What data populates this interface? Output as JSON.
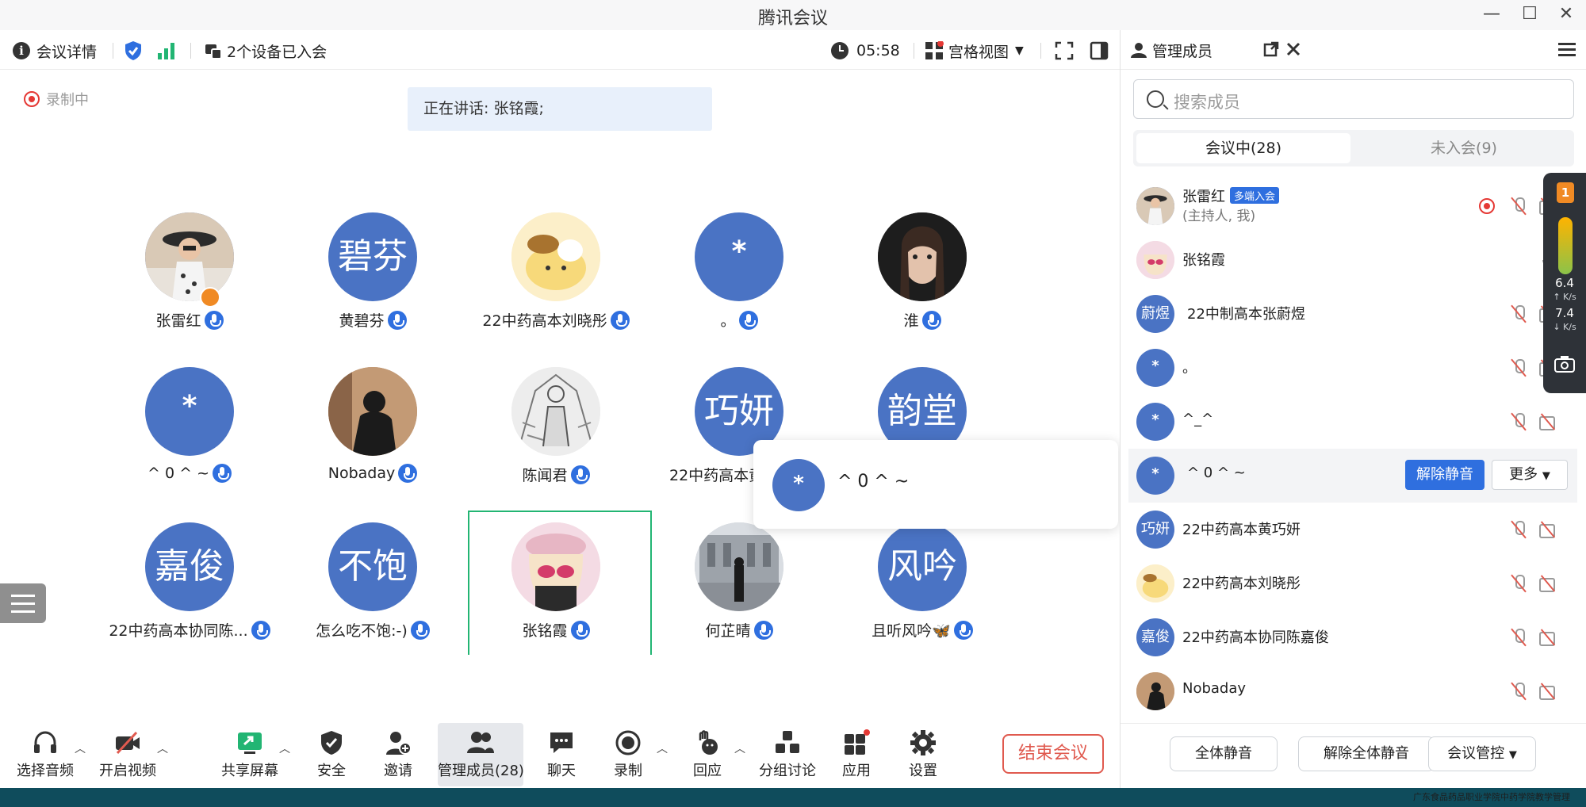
{
  "window": {
    "title": "腾讯会议"
  },
  "toolbar": {
    "meeting_details": "会议详情",
    "devices_joined": "2个设备已入会",
    "timer": "05:58",
    "view_mode": "宫格视图"
  },
  "recording": {
    "label": "录制中"
  },
  "speaking": {
    "text": "正在讲话: 张铭霞;"
  },
  "grid": {
    "tiles": [
      {
        "name": "张雷红",
        "avatar": "",
        "photo": "woman-hat"
      },
      {
        "name": "黄碧芬",
        "avatar": "碧芬"
      },
      {
        "name": "22中药高本刘晓彤",
        "avatar": "",
        "photo": "cartoon-dog"
      },
      {
        "name": "。",
        "avatar": "*"
      },
      {
        "name": "淮",
        "avatar": "",
        "photo": "girl-portrait"
      },
      {
        "name": "^ 0 ^ ~",
        "avatar": "*"
      },
      {
        "name": "Nobaday",
        "avatar": "",
        "photo": "dark-figure"
      },
      {
        "name": "陈闻君",
        "avatar": "",
        "photo": "sketch"
      },
      {
        "name": "22中药高本黄巧妍",
        "avatar": "巧妍"
      },
      {
        "name": "",
        "avatar": "韵堂"
      },
      {
        "name": "22中药高本协同陈...",
        "avatar": "嘉俊"
      },
      {
        "name": "怎么吃不饱:-)",
        "avatar": "不饱"
      },
      {
        "name": "张铭霞",
        "avatar": "",
        "photo": "anime-girl"
      },
      {
        "name": "何芷晴",
        "avatar": "",
        "photo": "building"
      },
      {
        "name": "且听风吟🦋",
        "avatar": "风吟"
      }
    ]
  },
  "popup": {
    "avatar": "*",
    "name": "^ 0 ^ ~"
  },
  "bottombar": {
    "audio": "选择音频",
    "video": "开启视频",
    "share": "共享屏幕",
    "security": "安全",
    "invite": "邀请",
    "members": "管理成员(28)",
    "chat": "聊天",
    "record": "录制",
    "reactions": "回应",
    "breakout": "分组讨论",
    "apps": "应用",
    "settings": "设置",
    "end": "结束会议"
  },
  "panel": {
    "title": "管理成员",
    "search_placeholder": "搜索成员",
    "tab_in": "会议中(28)",
    "tab_out": "未入会(9)",
    "members": [
      {
        "name": "张雷红",
        "tag": "多端入会",
        "role": "(主持人, 我)",
        "avatar": "",
        "photo": "woman-hat"
      },
      {
        "name": "张铭霞",
        "avatar": "",
        "photo": "anime-girl"
      },
      {
        "name": "22中制高本张蔚煜",
        "avatar": "蔚煜"
      },
      {
        "name": "。",
        "avatar": "*"
      },
      {
        "name": "^_^",
        "avatar": "*"
      },
      {
        "name": "^ 0 ^ ~",
        "avatar": "*",
        "unmute": "解除静音",
        "more": "更多"
      },
      {
        "name": "22中药高本黄巧妍",
        "avatar": "巧妍"
      },
      {
        "name": "22中药高本刘晓彤",
        "avatar": "",
        "photo": "cartoon-dog"
      },
      {
        "name": "22中药高本协同陈嘉俊",
        "avatar": "嘉俊"
      },
      {
        "name": "Nobaday",
        "avatar": "",
        "photo": "dark-figure"
      }
    ],
    "mute_all": "全体静音",
    "unmute_all": "解除全体静音",
    "controls": "会议管控"
  },
  "network": {
    "level": "1",
    "up": "6.4",
    "up_unit": "K/s",
    "down": "7.4",
    "down_unit": "K/s"
  },
  "footer_caption": "广东食品药品职业学院中药学院教学管理"
}
